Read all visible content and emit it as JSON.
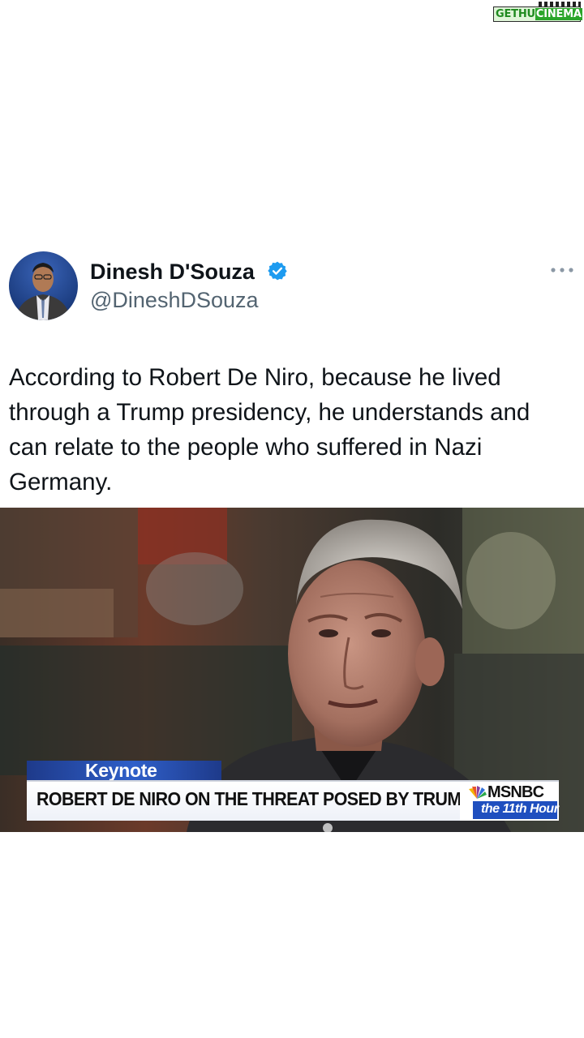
{
  "watermark": {
    "text_main": "GETHU",
    "text_accent": "CINEMA"
  },
  "tweet": {
    "display_name": "Dinesh D'Souza",
    "handle": "@DineshDSouza",
    "verified": true,
    "verified_color": "#1d9bf0",
    "more_icon": "more-horizontal-icon",
    "text": "According to Robert De Niro, because he lived through a Trump presidency, he understands and can relate to the people who suffered in Nazi Germany."
  },
  "media": {
    "segment_tag": "Keynote",
    "headline": "ROBERT DE NIRO ON THE THREAT POSED BY TRUMP",
    "network": "MSNBC",
    "show": "the 11th Hour",
    "accent_color": "#1f4fbf"
  }
}
